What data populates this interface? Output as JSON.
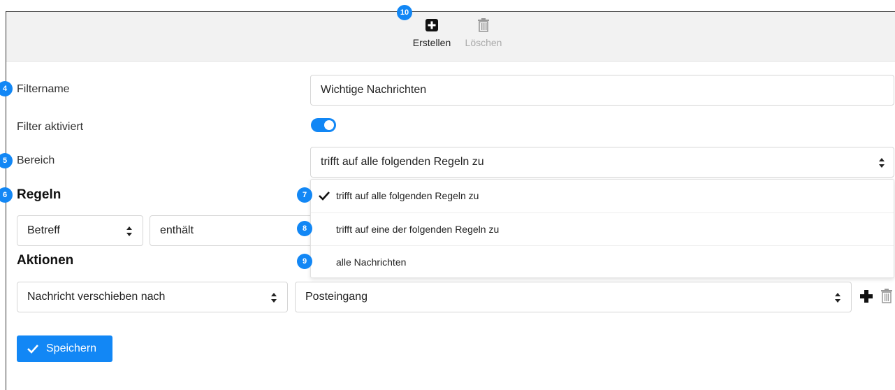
{
  "toolbar": {
    "create_label": "Erstellen",
    "delete_label": "Löschen",
    "create_icon": "plus-square-icon",
    "delete_icon": "trash-icon"
  },
  "badges": {
    "b4": "4",
    "b5": "5",
    "b6": "6",
    "b7": "7",
    "b8": "8",
    "b9": "9",
    "b10": "10"
  },
  "form": {
    "filtername_label": "Filtername",
    "filtername_value": "Wichtige Nachrichten",
    "enabled_label": "Filter aktiviert",
    "enabled": true,
    "scope_label": "Bereich",
    "scope_value": "trifft auf alle folgenden Regeln zu"
  },
  "scope_options": [
    {
      "label": "trifft auf alle folgenden Regeln zu",
      "selected": true
    },
    {
      "label": "trifft auf eine der folgenden Regeln zu",
      "selected": false
    },
    {
      "label": "alle Nachrichten",
      "selected": false
    }
  ],
  "rules": {
    "heading": "Regeln",
    "field_value": "Betreff",
    "operator_value": "enthält"
  },
  "actions": {
    "heading": "Aktionen",
    "action_value": "Nachricht verschieben nach",
    "target_value": "Posteingang"
  },
  "save_label": "Speichern",
  "colors": {
    "accent": "#1287f5",
    "toolbar_bg": "#f2f2f2"
  }
}
